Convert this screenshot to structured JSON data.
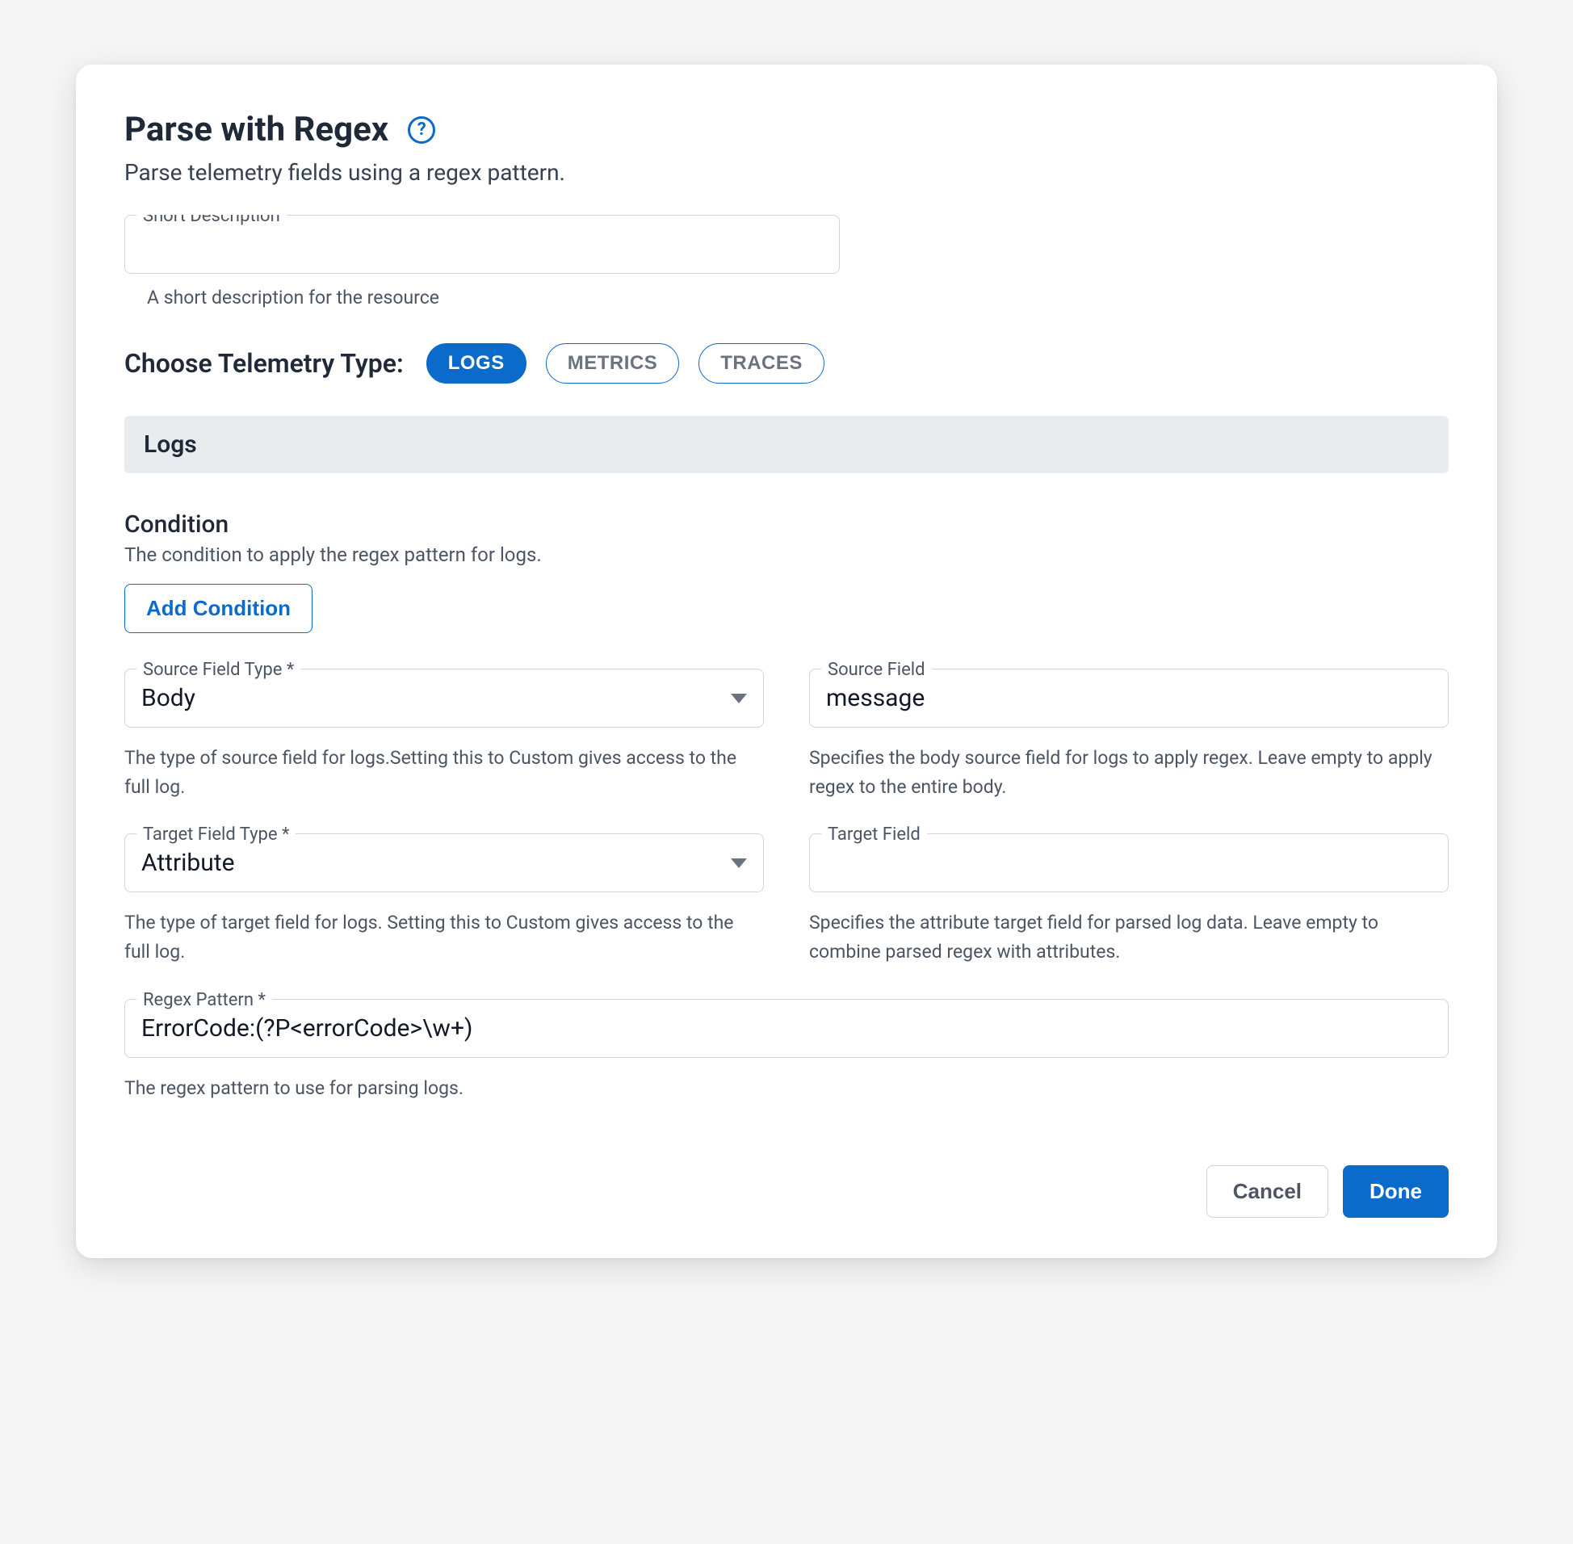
{
  "header": {
    "title": "Parse with Regex",
    "subtitle": "Parse telemetry fields using a regex pattern."
  },
  "shortDescription": {
    "label": "Short Description",
    "value": "",
    "helper": "A short description for the resource"
  },
  "telemetry": {
    "label": "Choose Telemetry Type:",
    "options": {
      "logs": "LOGS",
      "metrics": "METRICS",
      "traces": "TRACES"
    }
  },
  "section": {
    "band": "Logs"
  },
  "condition": {
    "title": "Condition",
    "desc": "The condition to apply the regex pattern for logs.",
    "addBtn": "Add Condition"
  },
  "fields": {
    "sourceFieldType": {
      "label": "Source Field Type *",
      "value": "Body",
      "helper": "The type of source field for logs.Setting this to Custom gives access to the full log."
    },
    "sourceField": {
      "label": "Source Field",
      "value": "message",
      "helper": "Specifies the body source field for logs to apply regex. Leave empty to apply regex to the entire body."
    },
    "targetFieldType": {
      "label": "Target Field Type *",
      "value": "Attribute",
      "helper": "The type of target field for logs. Setting this to Custom gives access to the full log."
    },
    "targetField": {
      "label": "Target Field",
      "value": "",
      "helper": "Specifies the attribute target field for parsed log data. Leave empty to combine parsed regex with attributes."
    },
    "regexPattern": {
      "label": "Regex Pattern *",
      "value": "ErrorCode:(?P<errorCode>\\w+)",
      "helper": "The regex pattern to use for parsing logs."
    }
  },
  "actions": {
    "cancel": "Cancel",
    "done": "Done"
  }
}
